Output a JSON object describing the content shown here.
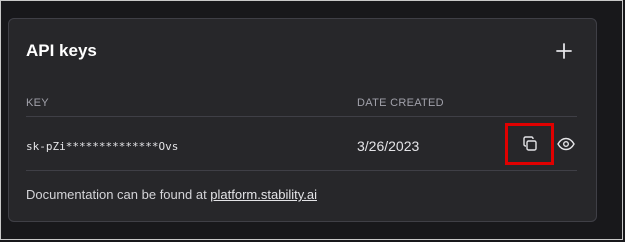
{
  "card": {
    "title": "API keys",
    "add_icon": "plus-icon"
  },
  "table": {
    "columns": [
      "KEY",
      "DATE CREATED"
    ],
    "rows": [
      {
        "key": "sk-pZi**************Ovs",
        "date_created": "3/26/2023",
        "actions": [
          "copy-icon",
          "eye-icon"
        ]
      }
    ]
  },
  "footer": {
    "text": "Documentation can be found at ",
    "link": "platform.stability.ai"
  },
  "colors": {
    "background": "#18181b",
    "card": "#27272a",
    "highlight": "#e00000"
  }
}
